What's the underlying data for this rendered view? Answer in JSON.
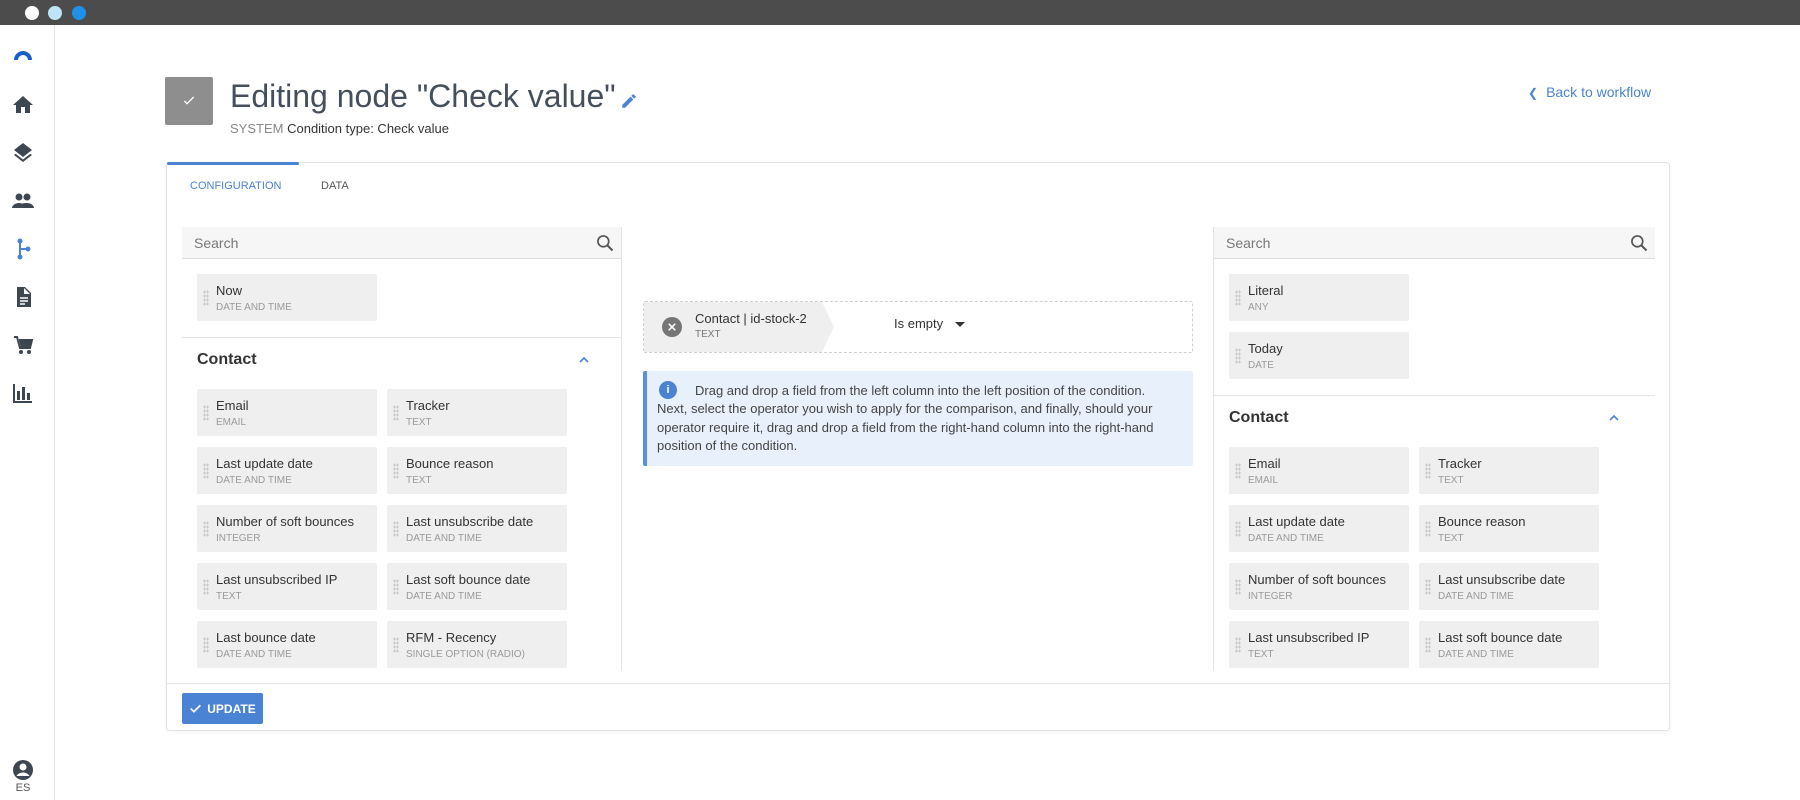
{
  "header": {
    "title": "Editing node \"Check value\"",
    "category": "SYSTEM",
    "subtitle": "Condition type: Check value",
    "back_label": "Back to workflow"
  },
  "sidebar": {
    "items": [
      {
        "icon": "logo-icon"
      },
      {
        "icon": "home-icon"
      },
      {
        "icon": "layers-icon"
      },
      {
        "icon": "people-icon"
      },
      {
        "icon": "workflow-icon",
        "active": true
      },
      {
        "icon": "document-icon"
      },
      {
        "icon": "cart-icon"
      },
      {
        "icon": "chart-icon"
      },
      {
        "icon": "account-icon"
      }
    ],
    "language": "ES"
  },
  "tabs": [
    {
      "label": "Configuration",
      "active": true
    },
    {
      "label": "Data"
    }
  ],
  "left_panel": {
    "search_placeholder": "Search",
    "top_fields": [
      {
        "name": "Now",
        "type": "DATE AND TIME"
      }
    ],
    "group_title": "Contact",
    "fields": [
      {
        "name": "Email",
        "type": "EMAIL"
      },
      {
        "name": "Tracker",
        "type": "TEXT"
      },
      {
        "name": "Last update date",
        "type": "DATE AND TIME"
      },
      {
        "name": "Bounce reason",
        "type": "TEXT"
      },
      {
        "name": "Number of soft bounces",
        "type": "INTEGER"
      },
      {
        "name": "Last unsubscribe date",
        "type": "DATE AND TIME"
      },
      {
        "name": "Last unsubscribed IP",
        "type": "TEXT"
      },
      {
        "name": "Last soft bounce date",
        "type": "DATE AND TIME"
      },
      {
        "name": "Last bounce date",
        "type": "DATE AND TIME"
      },
      {
        "name": "RFM - Recency",
        "type": "SINGLE OPTION (RADIO)"
      }
    ]
  },
  "condition": {
    "field_name": "Contact | id-stock-2",
    "field_type": "TEXT",
    "operator": "Is empty"
  },
  "info_text": "Drag and drop a field from the left column into the left position of the condition. Next, select the operator you wish to apply for the comparison, and finally, should your operator require it, drag and drop a field from the right-hand column into the right-hand position of the condition.",
  "right_panel": {
    "search_placeholder": "Search",
    "top_fields": [
      {
        "name": "Literal",
        "type": "ANY"
      },
      {
        "name": "Today",
        "type": "DATE"
      }
    ],
    "group_title": "Contact",
    "fields": [
      {
        "name": "Email",
        "type": "EMAIL"
      },
      {
        "name": "Tracker",
        "type": "TEXT"
      },
      {
        "name": "Last update date",
        "type": "DATE AND TIME"
      },
      {
        "name": "Bounce reason",
        "type": "TEXT"
      },
      {
        "name": "Number of soft bounces",
        "type": "INTEGER"
      },
      {
        "name": "Last unsubscribe date",
        "type": "DATE AND TIME"
      },
      {
        "name": "Last unsubscribed IP",
        "type": "TEXT"
      },
      {
        "name": "Last soft bounce date",
        "type": "DATE AND TIME"
      }
    ]
  },
  "footer": {
    "update_label": "Update"
  },
  "colors": {
    "accent": "#4a82d4",
    "info_bg": "#e8f0fc",
    "field_bg": "#efefef",
    "topbar": "#4c4c4c"
  }
}
